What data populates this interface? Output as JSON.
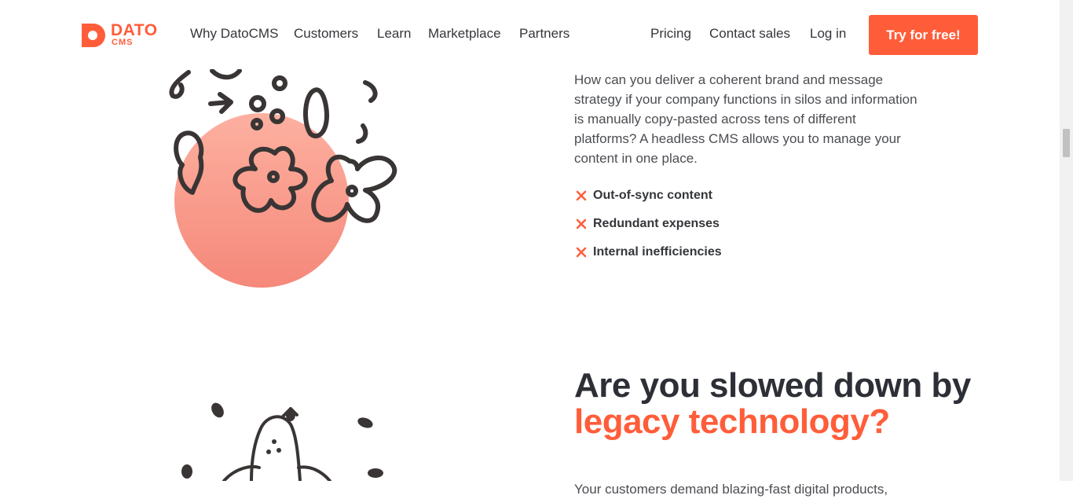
{
  "header": {
    "logo_word": "DATO",
    "logo_sub": "CMS",
    "nav_left": [
      "Why DatoCMS",
      "Customers",
      "Learn",
      "Marketplace",
      "Partners"
    ],
    "nav_right": [
      "Pricing",
      "Contact sales",
      "Log in"
    ],
    "cta_label": "Try for free!"
  },
  "section1": {
    "paragraph": "How can you deliver a coherent brand and message strategy if your company functions in silos and information is manually copy-pasted across tens of different platforms? A headless CMS allows you to manage your content in one place.",
    "features": [
      "Out-of-sync content",
      "Redundant expenses",
      "Internal inefficiencies"
    ]
  },
  "section2": {
    "heading_line1": "Are you slowed down by",
    "heading_line2": "legacy technology?",
    "paragraph": "Your customers demand blazing-fast digital products,"
  },
  "colors": {
    "accent": "#ff5d3a",
    "text": "#34363a",
    "circle": "#f99585"
  },
  "icons": {
    "feature_marker": "x-mark-icon",
    "logo": "datocms-logo-icon"
  }
}
